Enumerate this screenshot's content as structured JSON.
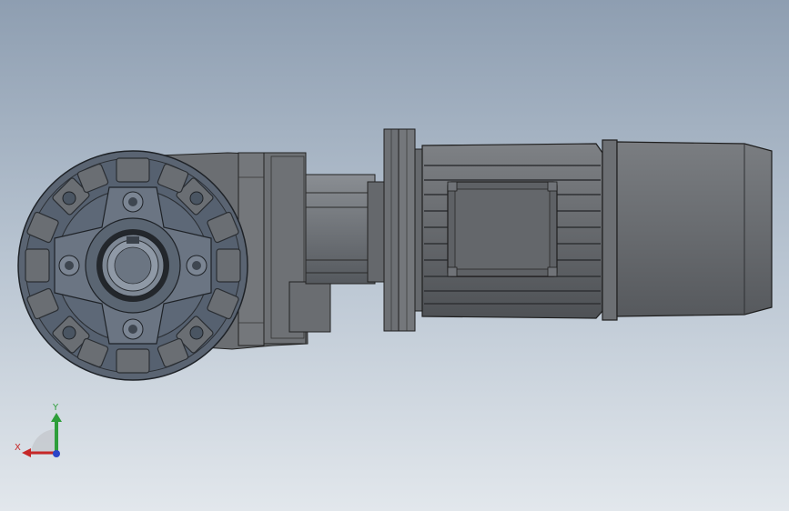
{
  "viewport": {
    "background_top": "#8e9eb1",
    "background_bottom": "#e2e7ec"
  },
  "triad": {
    "x_label": "X",
    "y_label": "Y",
    "x_color": "#c62828",
    "y_color": "#2e9e3a",
    "z_color": "#2b44c8"
  },
  "model": {
    "parts": [
      "gearbox-housing",
      "flange",
      "coupling",
      "motor-body",
      "fan-cover"
    ]
  }
}
